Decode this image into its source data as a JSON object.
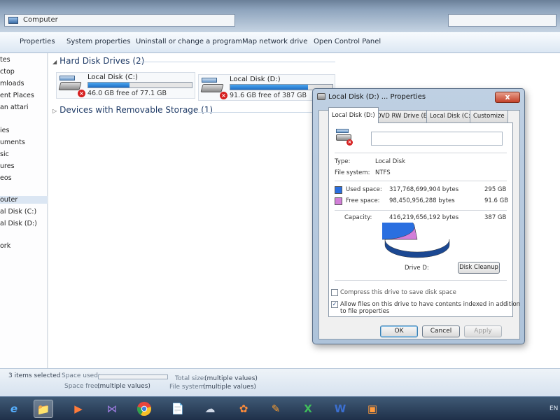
{
  "window": {
    "address": "Computer"
  },
  "toolbar": {
    "properties": "Properties",
    "system_properties": "System properties",
    "uninstall": "Uninstall or change a program",
    "map_network": "Map network drive",
    "open_control_panel": "Open Control Panel"
  },
  "nav": {
    "items": [
      "tes",
      "ctop",
      "mloads",
      "ent Places",
      "an attari",
      "ies",
      "uments",
      "sic",
      "ures",
      "eos",
      "outer",
      "al Disk (C:)",
      "al Disk (D:)",
      "ork"
    ]
  },
  "content": {
    "hard_drives_header": "Hard Disk Drives (2)",
    "removable_header": "Devices with Removable Storage (1)",
    "drives": [
      {
        "name": "Local Disk (C:)",
        "free_text": "46.0 GB free of 77.1 GB",
        "used_fraction": 0.4
      },
      {
        "name": "Local Disk (D:)",
        "free_text": "91.6 GB free of 387 GB",
        "used_fraction": 0.76
      }
    ]
  },
  "status": {
    "selected": "3 items selected",
    "space_used_label": "Space used:",
    "space_free_label": "Space free:",
    "space_free_value": "(multiple values)",
    "total_size_label": "Total size:",
    "total_size_value": "(multiple values)",
    "file_system_label": "File system:",
    "file_system_value": "(multiple values)"
  },
  "taskbar": {
    "lang": "EN"
  },
  "dialog": {
    "title": "Local Disk (D:) ... Properties",
    "close": "x",
    "tabs": [
      "Local Disk (D:)",
      "DVD RW Drive (E:)",
      "Local Disk (C:)",
      "Customize"
    ],
    "type_label": "Type:",
    "type_value": "Local Disk",
    "fs_label": "File system:",
    "fs_value": "NTFS",
    "used_label": "Used space:",
    "used_bytes": "317,768,699,904 bytes",
    "used_gb": "295 GB",
    "free_label": "Free space:",
    "free_bytes": "98,450,956,288 bytes",
    "free_gb": "91.6 GB",
    "capacity_label": "Capacity:",
    "capacity_bytes": "416,219,656,192 bytes",
    "capacity_gb": "387 GB",
    "drive_label": "Drive D:",
    "disk_cleanup": "Disk Cleanup",
    "compress": "Compress this drive to save disk space",
    "index_line1": "Allow files on this drive to have contents indexed in addition",
    "index_line2": "to file properties",
    "ok": "OK",
    "cancel": "Cancel",
    "apply": "Apply",
    "used_color": "#2a6fe0",
    "free_color": "#d27fd8",
    "used_fraction": 0.763
  }
}
